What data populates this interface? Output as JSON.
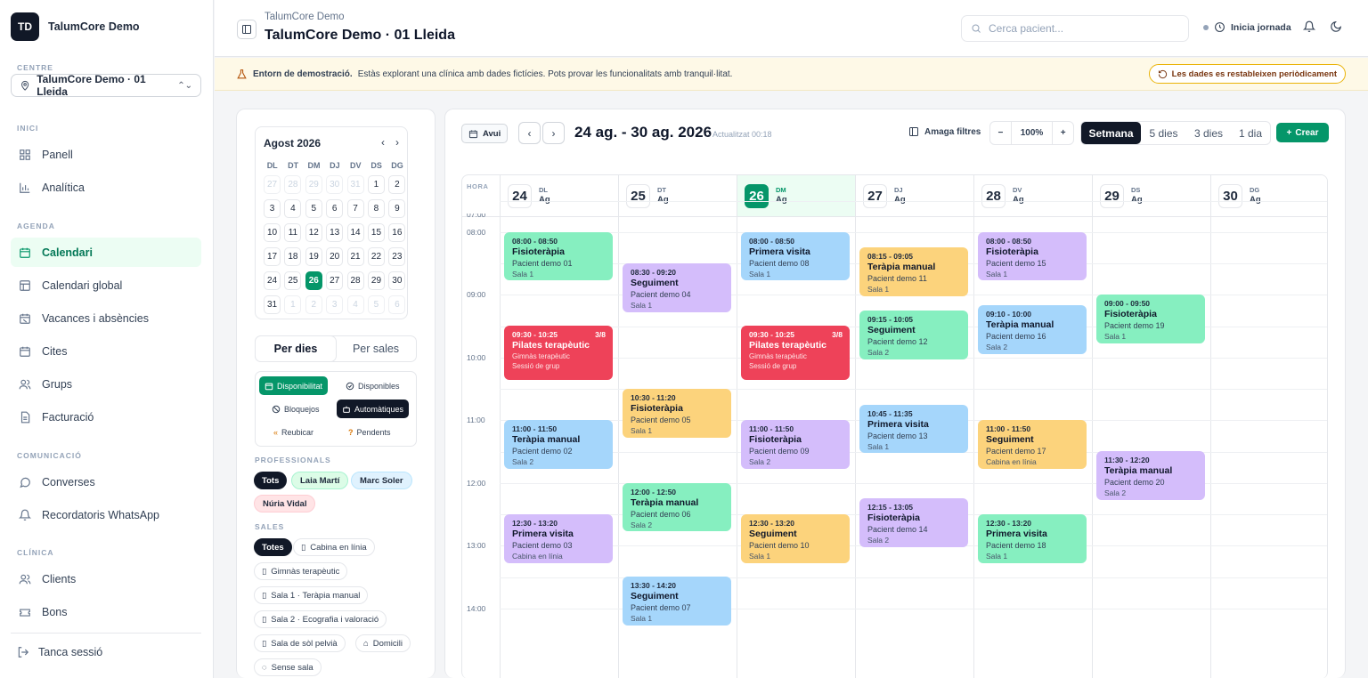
{
  "brand": {
    "initials": "TD",
    "name": "TalumCore Demo"
  },
  "sidebar": {
    "centre_label": "CENTRE",
    "centre_value": "TalumCore Demo · 01 Lleida",
    "sections": {
      "inici": "INICI",
      "agenda": "AGENDA",
      "comunicacio": "COMUNICACIÓ",
      "clinica": "CLÍNICA"
    },
    "items": {
      "panell": "Panell",
      "analitica": "Analítica",
      "calendari": "Calendari",
      "calendari_global": "Calendari global",
      "vacances": "Vacances i absències",
      "cites": "Cites",
      "grups": "Grups",
      "facturacio": "Facturació",
      "converses": "Converses",
      "recordatoris": "Recordatoris WhatsApp",
      "clients": "Clients",
      "bons": "Bons"
    },
    "logout": "Tanca sessió"
  },
  "topbar": {
    "subtitle": "TalumCore Demo",
    "title": "TalumCore Demo · 01 Lleida",
    "search_placeholder": "Cerca pacient...",
    "jornada": "Inicia jornada"
  },
  "banner": {
    "bold": "Entorn de demostració.",
    "text": "Estàs explorant una clínica amb dades fictícies. Pots provar les funcionalitats amb tranquil·litat.",
    "reset": "Les dades es restableixen periòdicament"
  },
  "mini": {
    "month": "Agost 2026",
    "dows": [
      "DL",
      "DT",
      "DM",
      "DJ",
      "DV",
      "DS",
      "DG"
    ],
    "days": [
      {
        "n": "27",
        "m": true
      },
      {
        "n": "28",
        "m": true
      },
      {
        "n": "29",
        "m": true
      },
      {
        "n": "30",
        "m": true
      },
      {
        "n": "31",
        "m": true
      },
      {
        "n": "1"
      },
      {
        "n": "2"
      },
      {
        "n": "3"
      },
      {
        "n": "4"
      },
      {
        "n": "5"
      },
      {
        "n": "6"
      },
      {
        "n": "7"
      },
      {
        "n": "8"
      },
      {
        "n": "9"
      },
      {
        "n": "10"
      },
      {
        "n": "11"
      },
      {
        "n": "12"
      },
      {
        "n": "13"
      },
      {
        "n": "14"
      },
      {
        "n": "15"
      },
      {
        "n": "16"
      },
      {
        "n": "17"
      },
      {
        "n": "18"
      },
      {
        "n": "19"
      },
      {
        "n": "20"
      },
      {
        "n": "21"
      },
      {
        "n": "22"
      },
      {
        "n": "23"
      },
      {
        "n": "24"
      },
      {
        "n": "25"
      },
      {
        "n": "26",
        "sel": true
      },
      {
        "n": "27"
      },
      {
        "n": "28"
      },
      {
        "n": "29"
      },
      {
        "n": "30"
      },
      {
        "n": "31"
      },
      {
        "n": "1",
        "m": true
      },
      {
        "n": "2",
        "m": true
      },
      {
        "n": "3",
        "m": true
      },
      {
        "n": "4",
        "m": true
      },
      {
        "n": "5",
        "m": true
      },
      {
        "n": "6",
        "m": true
      }
    ]
  },
  "mode": {
    "per_dies": "Per dies",
    "per_sales": "Per sales"
  },
  "filters": {
    "disponibilitat": "Disponibilitat",
    "disponibles": "Disponibles",
    "bloquejos": "Bloquejos",
    "automatiques": "Automàtiques",
    "reubicar": "Reubicar",
    "pendents": "Pendents"
  },
  "professionals": {
    "label": "PROFESSIONALS",
    "tots": "Tots",
    "laia": "Laia Martí",
    "marc": "Marc Soler",
    "nuria": "Núria Vidal"
  },
  "sales": {
    "label": "SALES",
    "totes": "Totes",
    "cabina": "Cabina en línia",
    "gimnas": "Gimnàs terapèutic",
    "sala1": "Sala 1 · Teràpia manual",
    "sala2": "Sala 2 · Ecografia i valoració",
    "sol": "Sala de sòl pelvià",
    "domicili": "Domicili",
    "sense": "Sense sala"
  },
  "toolbar": {
    "avui": "Avui",
    "range": "24 ag. - 30 ag. 2026",
    "updated": "· Actualitzat 00:18",
    "amaga": "Amaga filtres",
    "zoom": "100%",
    "views": [
      "Setmana",
      "5 dies",
      "3 dies",
      "1 dia"
    ],
    "crear": "Crear"
  },
  "grid": {
    "hora": "HORA",
    "hours": [
      "07:00",
      "08:00",
      "09:00",
      "10:00",
      "11:00",
      "12:00",
      "13:00",
      "14:00"
    ],
    "days": [
      {
        "num": "24",
        "dow": "DL",
        "mon": "Ag"
      },
      {
        "num": "25",
        "dow": "DT",
        "mon": "Ag"
      },
      {
        "num": "26",
        "dow": "DM",
        "mon": "Ag",
        "today": true
      },
      {
        "num": "27",
        "dow": "DJ",
        "mon": "Ag"
      },
      {
        "num": "28",
        "dow": "DV",
        "mon": "Ag"
      },
      {
        "num": "29",
        "dow": "DS",
        "mon": "Ag"
      },
      {
        "num": "30",
        "dow": "DG",
        "mon": "Ag"
      }
    ]
  },
  "colors": {
    "green": "#86efc0",
    "purple": "#d4bdfb",
    "yellow": "#fcd37c",
    "blue": "#a5d6fb",
    "red": "#ee4259",
    "accent": "#059669"
  },
  "events": [
    {
      "day": 0,
      "start": "08:00",
      "end": "08:50",
      "time": "08:00 - 08:50",
      "service": "Fisioteràpia",
      "patient": "Pacient demo 01",
      "room": "Sala 1",
      "color": "green"
    },
    {
      "day": 0,
      "start": "09:30",
      "end": "10:25",
      "time": "09:30 - 10:25",
      "service": "Pilates terapèutic",
      "patient": "Gimnàs terapèutic",
      "room": "Sessió de grup",
      "color": "red",
      "count": "3/8"
    },
    {
      "day": 0,
      "start": "11:00",
      "end": "11:50",
      "time": "11:00 - 11:50",
      "service": "Teràpia manual",
      "patient": "Pacient demo 02",
      "room": "Sala 2",
      "color": "blue"
    },
    {
      "day": 0,
      "start": "12:30",
      "end": "13:20",
      "time": "12:30 - 13:20",
      "service": "Primera visita",
      "patient": "Pacient demo 03",
      "room": "Cabina en línia",
      "color": "purple"
    },
    {
      "day": 1,
      "start": "08:30",
      "end": "09:20",
      "time": "08:30 - 09:20",
      "service": "Seguiment",
      "patient": "Pacient demo 04",
      "room": "Sala 1",
      "color": "purple"
    },
    {
      "day": 1,
      "start": "10:30",
      "end": "11:20",
      "time": "10:30 - 11:20",
      "service": "Fisioteràpia",
      "patient": "Pacient demo 05",
      "room": "Sala 1",
      "color": "yellow"
    },
    {
      "day": 1,
      "start": "12:00",
      "end": "12:50",
      "time": "12:00 - 12:50",
      "service": "Teràpia manual",
      "patient": "Pacient demo 06",
      "room": "Sala 2",
      "color": "green"
    },
    {
      "day": 1,
      "start": "13:30",
      "end": "14:20",
      "time": "13:30 - 14:20",
      "service": "Seguiment",
      "patient": "Pacient demo 07",
      "room": "Sala 1",
      "color": "blue"
    },
    {
      "day": 2,
      "start": "08:00",
      "end": "08:50",
      "time": "08:00 - 08:50",
      "service": "Primera visita",
      "patient": "Pacient demo 08",
      "room": "Sala 1",
      "color": "blue"
    },
    {
      "day": 2,
      "start": "09:30",
      "end": "10:25",
      "time": "09:30 - 10:25",
      "service": "Pilates terapèutic",
      "patient": "Gimnàs terapèutic",
      "room": "Sessió de grup",
      "color": "red",
      "count": "3/8"
    },
    {
      "day": 2,
      "start": "11:00",
      "end": "11:50",
      "time": "11:00 - 11:50",
      "service": "Fisioteràpia",
      "patient": "Pacient demo 09",
      "room": "Sala 2",
      "color": "purple"
    },
    {
      "day": 2,
      "start": "12:30",
      "end": "13:20",
      "time": "12:30 - 13:20",
      "service": "Seguiment",
      "patient": "Pacient demo 10",
      "room": "Sala 1",
      "color": "yellow"
    },
    {
      "day": 3,
      "start": "08:15",
      "end": "09:05",
      "time": "08:15 - 09:05",
      "service": "Teràpia manual",
      "patient": "Pacient demo 11",
      "room": "Sala 1",
      "color": "yellow"
    },
    {
      "day": 3,
      "start": "09:15",
      "end": "10:05",
      "time": "09:15 - 10:05",
      "service": "Seguiment",
      "patient": "Pacient demo 12",
      "room": "Sala 2",
      "color": "green"
    },
    {
      "day": 3,
      "start": "10:45",
      "end": "11:35",
      "time": "10:45 - 11:35",
      "service": "Primera visita",
      "patient": "Pacient demo 13",
      "room": "Sala 1",
      "color": "blue"
    },
    {
      "day": 3,
      "start": "12:15",
      "end": "13:05",
      "time": "12:15 - 13:05",
      "service": "Fisioteràpia",
      "patient": "Pacient demo 14",
      "room": "Sala 2",
      "color": "purple"
    },
    {
      "day": 4,
      "start": "08:00",
      "end": "08:50",
      "time": "08:00 - 08:50",
      "service": "Fisioteràpia",
      "patient": "Pacient demo 15",
      "room": "Sala 1",
      "color": "purple"
    },
    {
      "day": 4,
      "start": "09:10",
      "end": "10:00",
      "time": "09:10 - 10:00",
      "service": "Teràpia manual",
      "patient": "Pacient demo 16",
      "room": "Sala 2",
      "color": "blue"
    },
    {
      "day": 4,
      "start": "11:00",
      "end": "11:50",
      "time": "11:00 - 11:50",
      "service": "Seguiment",
      "patient": "Pacient demo 17",
      "room": "Cabina en línia",
      "color": "yellow"
    },
    {
      "day": 4,
      "start": "12:30",
      "end": "13:20",
      "time": "12:30 - 13:20",
      "service": "Primera visita",
      "patient": "Pacient demo 18",
      "room": "Sala 1",
      "color": "green"
    },
    {
      "day": 5,
      "start": "09:00",
      "end": "09:50",
      "time": "09:00 - 09:50",
      "service": "Fisioteràpia",
      "patient": "Pacient demo 19",
      "room": "Sala 1",
      "color": "green"
    },
    {
      "day": 5,
      "start": "11:30",
      "end": "12:20",
      "time": "11:30 - 12:20",
      "service": "Teràpia manual",
      "patient": "Pacient demo 20",
      "room": "Sala 2",
      "color": "purple"
    }
  ]
}
